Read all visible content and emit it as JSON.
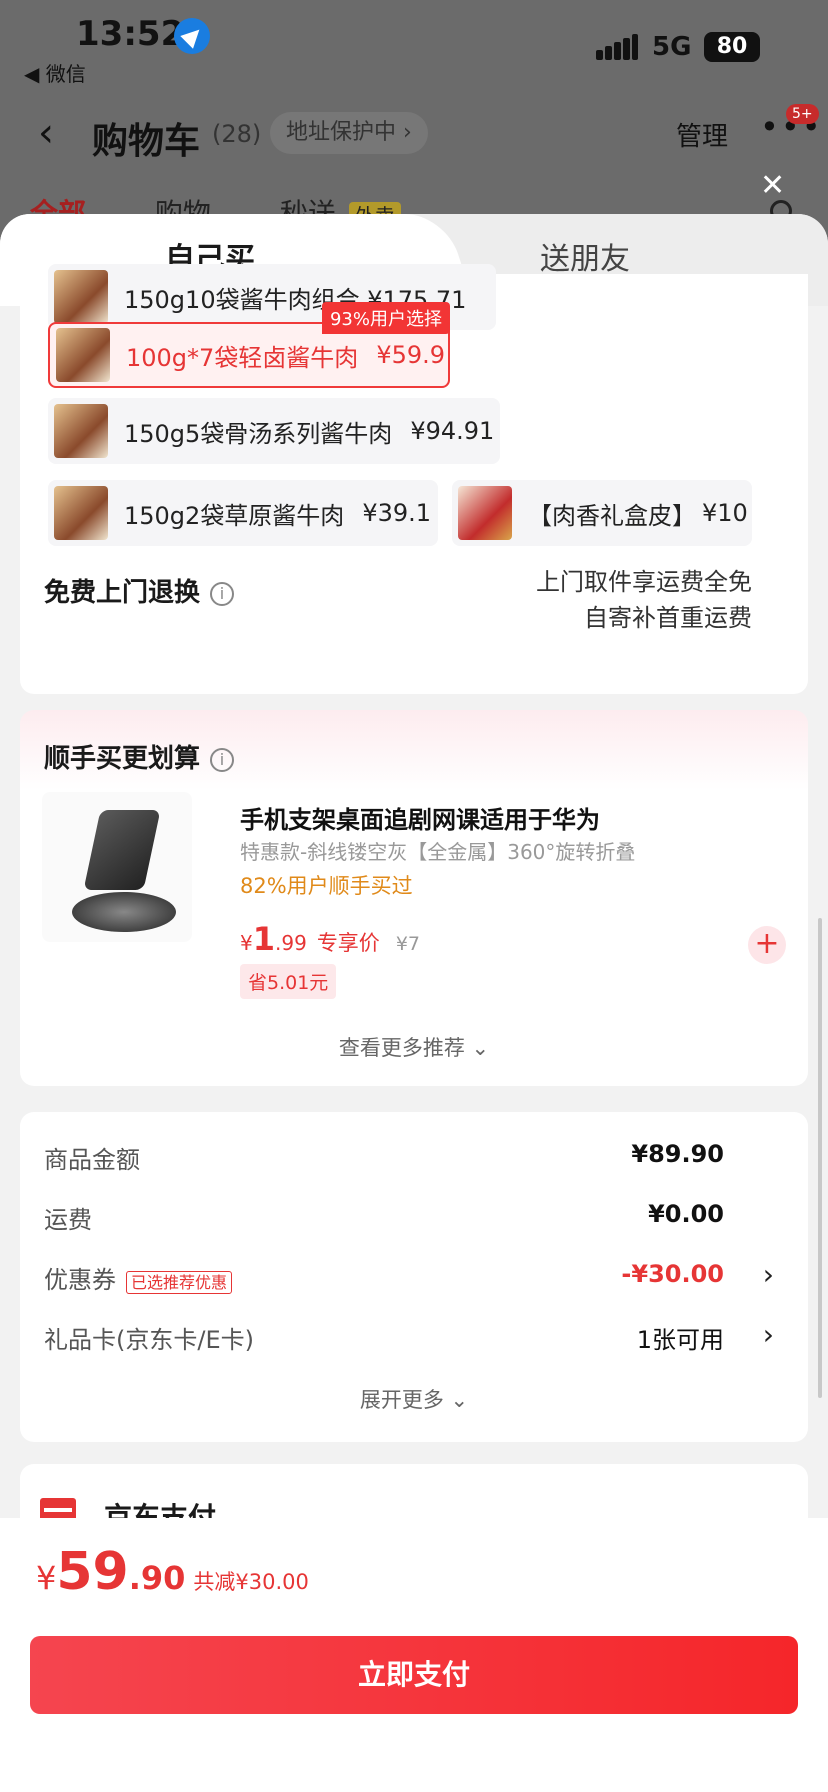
{
  "status_bar": {
    "time": "13:52",
    "back_app": "◀ 微信",
    "network": "5G",
    "battery": "80"
  },
  "background_page": {
    "title": "购物车",
    "count": "(28)",
    "address_protect": "地址保护中 ›",
    "manage": "管理",
    "more": "•••",
    "message_badge": "5+",
    "tabs": [
      "全部",
      "购物",
      "秒送"
    ],
    "waimai_tag": "外卖"
  },
  "sheet": {
    "tabs": {
      "self": "自己买",
      "gift": "送朋友"
    },
    "spec_options": [
      {
        "label": "150g10袋酱牛肉组合 ¥175.71"
      },
      {
        "label": "100g*7袋轻卤酱牛肉",
        "price": "¥59.9",
        "tag": "93%用户选择",
        "selected": true
      },
      {
        "label": "150g5袋骨汤系列酱牛肉",
        "price": "¥94.91"
      },
      {
        "label": "150g2袋草原酱牛肉",
        "price": "¥39.1"
      },
      {
        "label": "【肉香礼盒皮】",
        "price": "¥10"
      }
    ],
    "free_return": "免费上门退换",
    "return_note_1": "上门取件享运费全免",
    "return_note_2": "自寄补首重运费",
    "upsell": {
      "heading": "顺手买更划算",
      "product_title": "手机支架桌面追剧网课适用于华为",
      "product_spec": "特惠款-斜线镂空灰【全金属】360°旋转折叠",
      "popularity": "82%用户顺手买过",
      "price_yen": "¥",
      "price_int": "1",
      "price_dec": ".99",
      "price_label": "专享价",
      "orig_price": "¥7",
      "save": "省5.01元",
      "see_more": "查看更多推荐 ⌄"
    },
    "summary": {
      "goods_label": "商品金额",
      "goods_value": "¥89.90",
      "freight_label": "运费",
      "freight_value": "¥0.00",
      "coupon_label": "优惠券",
      "coupon_tag": "已选推荐优惠",
      "coupon_value": "-¥30.00",
      "giftcard_label": "礼品卡(京东卡/E卡)",
      "giftcard_value": "1张可用",
      "expand_more": "展开更多 ⌄"
    },
    "payment": {
      "method": "京东支付"
    }
  },
  "bottom_bar": {
    "yen": "¥",
    "total_int": "59",
    "total_dec": ".90",
    "saved": "共减¥30.00",
    "pay_button": "立即支付"
  },
  "colors": {
    "accent": "#e63535",
    "popularity": "#e08a1a"
  }
}
